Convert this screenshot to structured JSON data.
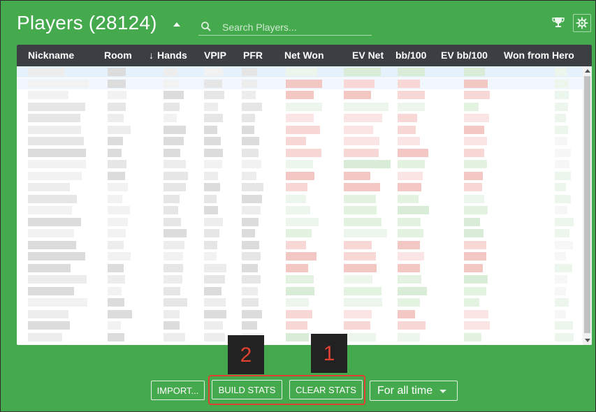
{
  "header": {
    "title": "Players (28124)",
    "search_placeholder": "Search Players..."
  },
  "table": {
    "sort_arrow": "↓",
    "columns": [
      {
        "key": "nickname",
        "label": "Nickname"
      },
      {
        "key": "room",
        "label": "Room"
      },
      {
        "key": "hands",
        "label": "Hands",
        "sorted": true
      },
      {
        "key": "vpip",
        "label": "VPIP"
      },
      {
        "key": "pfr",
        "label": "PFR"
      },
      {
        "key": "net_won",
        "label": "Net Won"
      },
      {
        "key": "ev_net",
        "label": "EV Net"
      },
      {
        "key": "bb100",
        "label": "bb/100"
      },
      {
        "key": "ev_bb100",
        "label": "EV bb/100"
      },
      {
        "key": "won_from_hero",
        "label": "Won from Hero"
      }
    ],
    "rows_note_hidden": "cell contents are pixelated/obscured in the screenshot"
  },
  "annotations": {
    "marker_1": "1",
    "marker_2": "2",
    "color": "#e04030"
  },
  "footer": {
    "import_label": "IMPORT...",
    "build_label": "BUILD STATS",
    "clear_label": "CLEAR STATS",
    "period_value": "For all time"
  },
  "colors": {
    "background": "#45a94d",
    "header_bar": "#3b3f43",
    "selected_row": "#e5f1fb",
    "negative": "#f5cccb",
    "positive": "#dfeedd"
  }
}
